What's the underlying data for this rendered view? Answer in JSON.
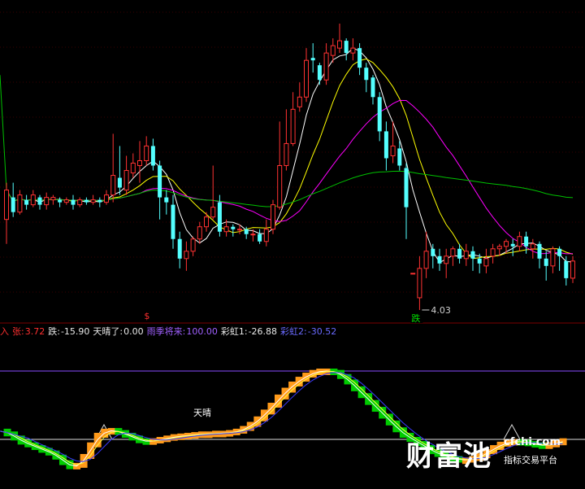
{
  "chart_data": [
    {
      "type": "candlestick",
      "y_marker": "4.03",
      "signals": [
        {
          "label": "$",
          "color": "#ff3030"
        },
        {
          "label": "跌",
          "color": "#00e000"
        }
      ],
      "candles": [
        [
          4.4,
          4.52,
          4.3,
          4.55
        ],
        [
          4.49,
          4.43,
          4.41,
          4.55
        ],
        [
          4.43,
          4.5,
          4.42,
          4.52
        ],
        [
          4.48,
          4.46,
          4.44,
          4.5
        ],
        [
          4.46,
          4.5,
          4.45,
          4.52
        ],
        [
          4.49,
          4.46,
          4.44,
          4.5
        ],
        [
          4.46,
          4.49,
          4.44,
          4.51
        ],
        [
          4.48,
          4.49,
          4.46,
          4.5
        ],
        [
          4.48,
          4.47,
          4.45,
          4.49
        ],
        [
          4.47,
          4.48,
          4.46,
          4.49
        ],
        [
          4.48,
          4.46,
          4.44,
          4.5
        ],
        [
          4.46,
          4.48,
          4.45,
          4.49
        ],
        [
          4.48,
          4.47,
          4.46,
          4.49
        ],
        [
          4.47,
          4.48,
          4.46,
          4.5
        ],
        [
          4.48,
          4.47,
          4.45,
          4.49
        ],
        [
          4.47,
          4.5,
          4.46,
          4.52
        ],
        [
          4.5,
          4.58,
          4.47,
          4.75
        ],
        [
          4.57,
          4.53,
          4.5,
          4.7
        ],
        [
          4.52,
          4.6,
          4.5,
          4.66
        ],
        [
          4.59,
          4.63,
          4.57,
          4.67
        ],
        [
          4.62,
          4.64,
          4.55,
          4.72
        ],
        [
          4.64,
          4.7,
          4.62,
          4.74
        ],
        [
          4.7,
          4.62,
          4.6,
          4.73
        ],
        [
          4.62,
          4.49,
          4.4,
          4.64
        ],
        [
          4.49,
          4.47,
          4.42,
          4.52
        ],
        [
          4.46,
          4.32,
          4.28,
          4.5
        ],
        [
          4.32,
          4.24,
          4.2,
          4.35
        ],
        [
          4.24,
          4.27,
          4.19,
          4.31
        ],
        [
          4.27,
          4.32,
          4.25,
          4.33
        ],
        [
          4.32,
          4.37,
          4.3,
          4.39
        ],
        [
          4.37,
          4.41,
          4.35,
          4.43
        ],
        [
          4.41,
          4.45,
          4.4,
          4.62
        ],
        [
          4.47,
          4.35,
          4.33,
          4.5
        ],
        [
          4.35,
          4.37,
          4.33,
          4.4
        ],
        [
          4.37,
          4.36,
          4.33,
          4.38
        ],
        [
          4.36,
          4.36,
          4.34,
          4.38
        ],
        [
          4.36,
          4.34,
          4.32,
          4.37
        ],
        [
          4.34,
          4.34,
          4.31,
          4.36
        ],
        [
          4.34,
          4.31,
          4.3,
          4.36
        ],
        [
          4.31,
          4.36,
          4.29,
          4.4
        ],
        [
          4.36,
          4.46,
          4.34,
          4.48
        ],
        [
          4.45,
          4.62,
          4.44,
          4.8
        ],
        [
          4.62,
          4.71,
          4.6,
          4.85
        ],
        [
          4.71,
          4.85,
          4.7,
          4.92
        ],
        [
          4.86,
          4.9,
          4.84,
          4.96
        ],
        [
          4.9,
          5.05,
          4.88,
          5.1
        ],
        [
          5.06,
          5.05,
          5.0,
          5.12
        ],
        [
          5.03,
          4.97,
          4.95,
          5.04
        ],
        [
          4.97,
          5.08,
          4.95,
          5.12
        ],
        [
          5.07,
          5.11,
          5.04,
          5.14
        ],
        [
          5.1,
          5.13,
          5.08,
          5.2
        ],
        [
          5.13,
          5.08,
          5.05,
          5.14
        ],
        [
          5.08,
          5.1,
          5.05,
          5.14
        ],
        [
          5.1,
          5.02,
          4.99,
          5.12
        ],
        [
          5.02,
          4.97,
          4.92,
          5.04
        ],
        [
          4.98,
          4.9,
          4.87,
          4.99
        ],
        [
          4.9,
          4.76,
          4.72,
          4.92
        ],
        [
          4.76,
          4.65,
          4.6,
          4.8
        ],
        [
          4.66,
          4.7,
          4.63,
          4.8
        ],
        [
          4.69,
          4.62,
          4.6,
          4.72
        ],
        [
          4.61,
          4.45,
          4.32,
          4.63
        ],
        [
          4.18,
          4.18,
          4.18,
          4.18
        ],
        [
          4.08,
          4.2,
          4.03,
          4.25
        ],
        [
          4.2,
          4.27,
          4.16,
          4.35
        ],
        [
          4.28,
          4.25,
          4.2,
          4.3
        ],
        [
          4.25,
          4.22,
          4.19,
          4.28
        ],
        [
          4.22,
          4.25,
          4.16,
          4.28
        ],
        [
          4.25,
          4.28,
          4.21,
          4.29
        ],
        [
          4.28,
          4.24,
          4.22,
          4.3
        ],
        [
          4.24,
          4.27,
          4.21,
          4.3
        ],
        [
          4.27,
          4.24,
          4.19,
          4.29
        ],
        [
          4.24,
          4.22,
          4.18,
          4.26
        ],
        [
          4.21,
          4.24,
          4.18,
          4.28
        ],
        [
          4.25,
          4.28,
          4.22,
          4.3
        ],
        [
          4.28,
          4.29,
          4.25,
          4.3
        ],
        [
          4.29,
          4.31,
          4.26,
          4.32
        ],
        [
          4.3,
          4.29,
          4.25,
          4.32
        ],
        [
          4.29,
          4.33,
          4.27,
          4.35
        ],
        [
          4.33,
          4.29,
          4.26,
          4.35
        ],
        [
          4.28,
          4.3,
          4.24,
          4.32
        ],
        [
          4.3,
          4.24,
          4.2,
          4.31
        ],
        [
          4.24,
          4.21,
          4.15,
          4.27
        ],
        [
          4.21,
          4.28,
          4.18,
          4.29
        ],
        [
          4.28,
          4.25,
          4.19,
          4.29
        ],
        [
          4.23,
          4.16,
          4.13,
          4.25
        ],
        [
          4.16,
          4.23,
          4.14,
          4.25
        ]
      ]
    },
    {
      "type": "indicator",
      "legend": [
        {
          "text": "入",
          "color": "#ff3030"
        },
        {
          "text": "张:",
          "color": "#ff3030"
        },
        {
          "text": "3.72",
          "color": "#ff3030"
        },
        {
          "text": "跌:",
          "color": "#e8e8e8"
        },
        {
          "text": "-15.90",
          "color": "#e8e8e8"
        },
        {
          "text": "天晴了:",
          "color": "#e8e8e8"
        },
        {
          "text": "0.00",
          "color": "#e8e8e8"
        },
        {
          "text": "雨季将来:",
          "color": "#a060ff"
        },
        {
          "text": "100.00",
          "color": "#a060ff"
        },
        {
          "text": "彩虹1:",
          "color": "#e8e8e8"
        },
        {
          "text": "-26.88",
          "color": "#e8e8e8"
        },
        {
          "text": "彩虹2:",
          "color": "#6a6aff"
        },
        {
          "text": "-30.52",
          "color": "#6a6aff"
        }
      ],
      "annotation": "天晴",
      "reference_levels": [
        100,
        0
      ],
      "values": [
        12,
        8,
        2,
        -4,
        -8,
        -12,
        -16,
        -20,
        -26,
        -34,
        -40,
        -38,
        -25,
        -8,
        6,
        12,
        13,
        10,
        6,
        2,
        -2,
        -3,
        -2,
        0,
        2,
        4,
        5,
        6,
        7,
        8,
        8,
        9,
        9,
        10,
        12,
        16,
        22,
        30,
        40,
        50,
        62,
        72,
        81,
        88,
        94,
        98,
        100,
        100,
        98,
        92,
        84,
        74,
        64,
        54,
        44,
        34,
        24,
        14,
        6,
        0,
        -6,
        -12,
        -18,
        -22,
        -26,
        -28,
        -30,
        -30,
        -28,
        -24,
        -18,
        -12,
        -7,
        -4,
        -3,
        -4,
        -6,
        -8,
        -9,
        -8,
        -5,
        -2
      ]
    }
  ],
  "watermark": {
    "brand": "财富池",
    "url": "cfchi.com",
    "tagline": "指标交易平台"
  }
}
